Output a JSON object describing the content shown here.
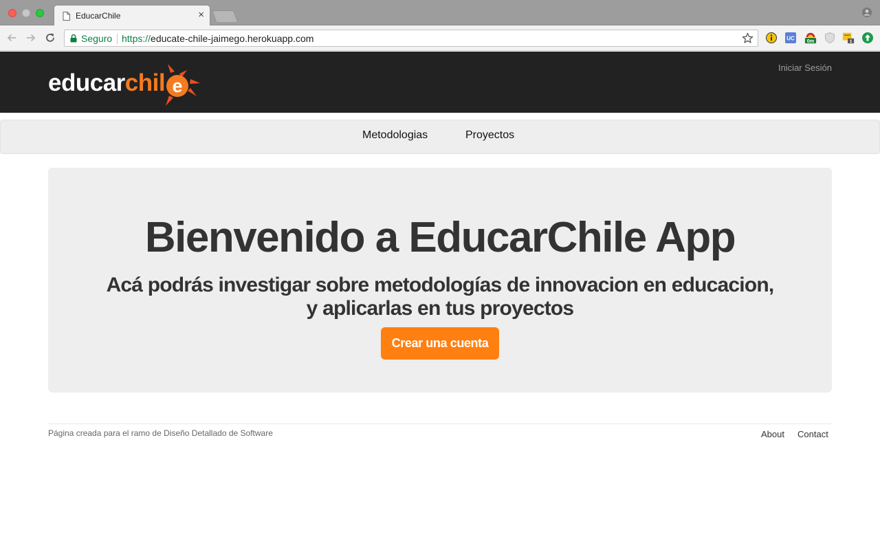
{
  "browser": {
    "tab_title": "EducarChile",
    "tab_close": "×",
    "security_label": "Seguro",
    "url_scheme": "https://",
    "url_host": "educate-chile-jaimego.herokuapp.com",
    "extensions": [
      {
        "name": "info-extension",
        "color": "#f4c20d"
      },
      {
        "name": "uc-extension",
        "label": "UC",
        "color": "#5b7fd6"
      },
      {
        "name": "timer-extension",
        "label": "0m",
        "color": "#c62828"
      },
      {
        "name": "shield-extension",
        "color": "#bdbdbd"
      },
      {
        "name": "notes-extension",
        "label": "1",
        "color": "#f6c21b"
      },
      {
        "name": "upload-extension",
        "color": "#1a9b4b"
      }
    ]
  },
  "site": {
    "logo_white": "educar",
    "logo_orange": "chil",
    "login_label": "Iniciar Sesión",
    "brand_color": "#f47b1f"
  },
  "nav": {
    "items": [
      {
        "label": "Metodologias"
      },
      {
        "label": "Proyectos"
      }
    ]
  },
  "hero": {
    "title": "Bienvenido a EducarChile App",
    "subtitle": "Acá podrás investigar sobre metodologías de innovacion en educacion, y aplicarlas en tus proyectos",
    "cta_label": "Crear una cuenta",
    "cta_color": "#ff7f11"
  },
  "footer": {
    "text": "Página creada para el ramo de Diseño Detallado de Software",
    "links": [
      {
        "label": "About"
      },
      {
        "label": "Contact"
      }
    ]
  }
}
